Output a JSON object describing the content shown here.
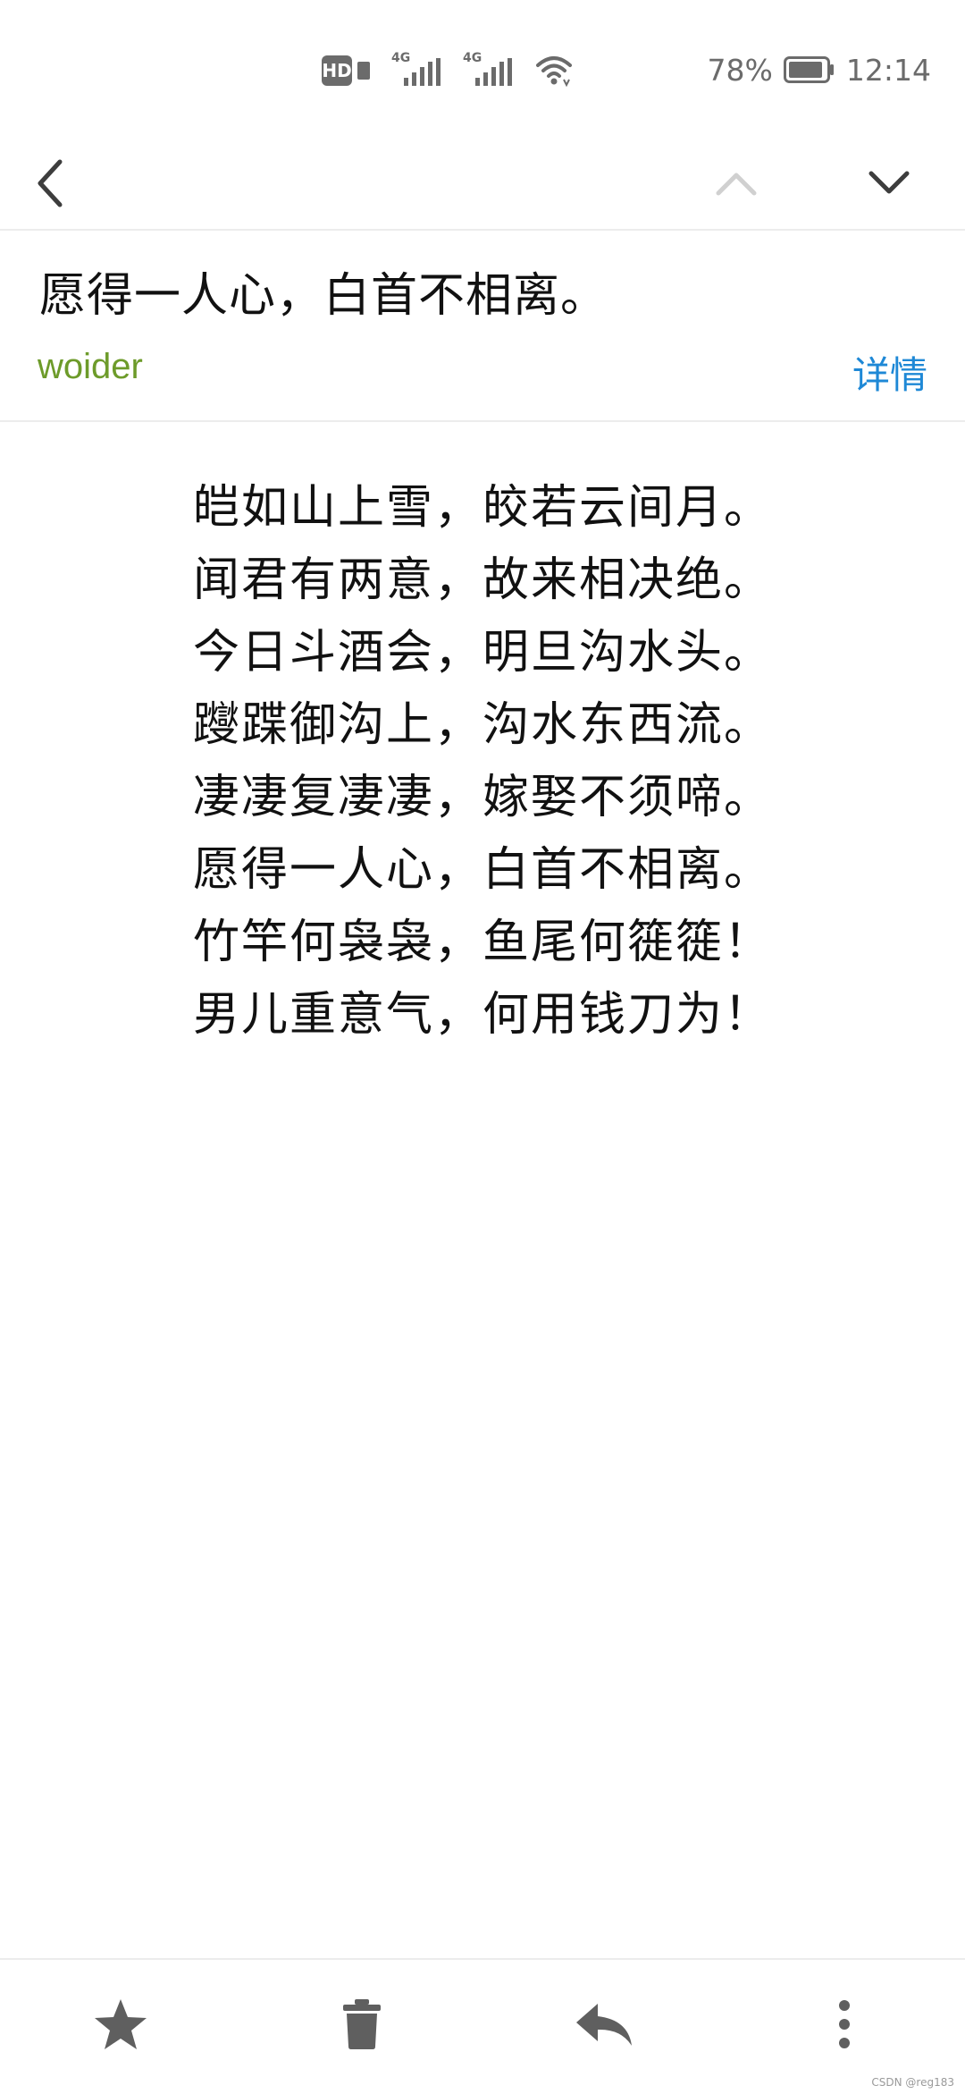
{
  "status_bar": {
    "hd_label": "HD",
    "sim1_network": "4G",
    "sim2_network": "4G",
    "battery_percent": "78%",
    "time": "12:14",
    "icons": [
      "hd-icon",
      "sim-icon",
      "signal-icon",
      "signal-icon",
      "wifi-icon",
      "battery-icon"
    ]
  },
  "toolbar": {
    "icons": [
      "back-arrow-icon",
      "previous-chevron-icon",
      "next-chevron-icon"
    ]
  },
  "mail": {
    "subject": "愿得一人心，白首不相离。",
    "sender": "woider",
    "details_label": "详情",
    "body_lines": [
      "皑如山上雪，皎若云间月。",
      "闻君有两意，故来相决绝。",
      "今日斗酒会，明旦沟水头。",
      "躞蹀御沟上，沟水东西流。",
      "凄凄复凄凄，嫁娶不须啼。",
      "愿得一人心，白首不相离。",
      "竹竿何袅袅，鱼尾何簁簁！",
      "男儿重意气，何用钱刀为！"
    ]
  },
  "bottom_bar": {
    "icons": [
      "star-icon",
      "trash-icon",
      "reply-icon",
      "more-vertical-icon"
    ]
  },
  "watermark": "CSDN @reg183",
  "colors": {
    "sender": "#6d9b2a",
    "link": "#1e88d6",
    "icon": "#5f5f5f",
    "icon_disabled": "#d0d0d0",
    "status_gray": "#6b6b6b"
  }
}
